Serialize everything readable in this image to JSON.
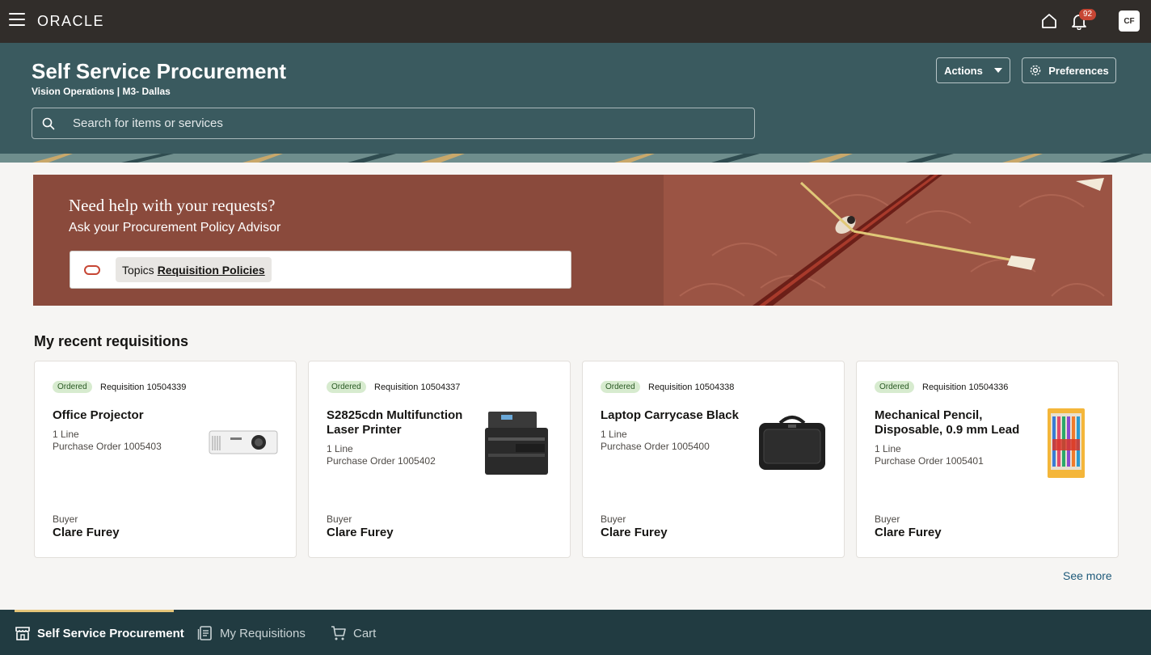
{
  "topbar": {
    "logo_text": "ORACLE",
    "notification_count": "92",
    "avatar_initials": "CF"
  },
  "header": {
    "title": "Self Service Procurement",
    "subtitle": "Vision Operations | M3- Dallas",
    "search_placeholder": "Search for items or services",
    "actions_label": "Actions",
    "preferences_label": "Preferences"
  },
  "banner": {
    "title": "Need help with your requests?",
    "subtitle": "Ask your Procurement Policy Advisor",
    "topics_label": "Topics",
    "topics_link": "Requisition Policies"
  },
  "recent": {
    "title": "My recent requisitions",
    "see_more": "See more",
    "cards": [
      {
        "status": "Ordered",
        "requisition": "Requisition 10504339",
        "item": "Office Projector",
        "lines": "1 Line",
        "po": "Purchase Order 1005403",
        "buyer_label": "Buyer",
        "buyer": "Clare Furey",
        "thumb_icon": "projector-icon"
      },
      {
        "status": "Ordered",
        "requisition": "Requisition 10504337",
        "item": "S2825cdn Multifunction Laser Printer",
        "lines": "1 Line",
        "po": "Purchase Order 1005402",
        "buyer_label": "Buyer",
        "buyer": "Clare Furey",
        "thumb_icon": "printer-icon"
      },
      {
        "status": "Ordered",
        "requisition": "Requisition 10504338",
        "item": "Laptop Carrycase Black",
        "lines": "1 Line",
        "po": "Purchase Order 1005400",
        "buyer_label": "Buyer",
        "buyer": "Clare Furey",
        "thumb_icon": "laptop-bag-icon"
      },
      {
        "status": "Ordered",
        "requisition": "Requisition 10504336",
        "item": "Mechanical Pencil, Disposable, 0.9 mm Lead",
        "lines": "1 Line",
        "po": "Purchase Order 1005401",
        "buyer_label": "Buyer",
        "buyer": "Clare Furey",
        "thumb_icon": "pencil-pack-icon"
      }
    ]
  },
  "bottom_nav": {
    "items": [
      {
        "label": "Self Service Procurement",
        "icon": "store-icon"
      },
      {
        "label": "My Requisitions",
        "icon": "requisitions-icon"
      },
      {
        "label": "Cart",
        "icon": "cart-icon"
      }
    ]
  },
  "colors": {
    "topbar": "#312d2a",
    "header": "#3a5a5f",
    "banner": "#8a4a3c",
    "bottombar": "#213b41",
    "ordered_pill": "#d7ebcf",
    "link": "#1e5a7a"
  }
}
